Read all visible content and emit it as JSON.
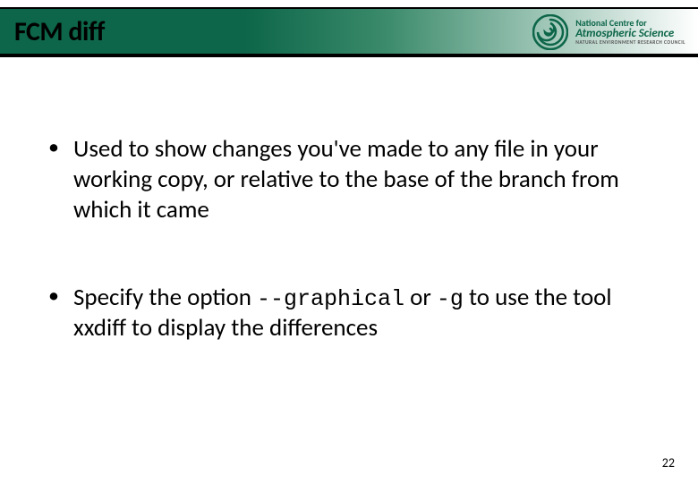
{
  "header": {
    "title": "FCM diff",
    "logo": {
      "line1": "National Centre for",
      "line2": "Atmospheric Science",
      "line3": "NATURAL ENVIRONMENT RESEARCH COUNCIL"
    }
  },
  "bullets": [
    {
      "pre": "Used to show changes you've made to any file in your working copy, or relative to the base of the branch from which it came",
      "code1": "",
      "mid": "",
      "code2": "",
      "post": ""
    },
    {
      "pre": "Specify the option ",
      "code1": "--graphical",
      "mid": " or ",
      "code2": "-g",
      "post": " to use the tool xxdiff to display the differences"
    }
  ],
  "page_number": "22"
}
